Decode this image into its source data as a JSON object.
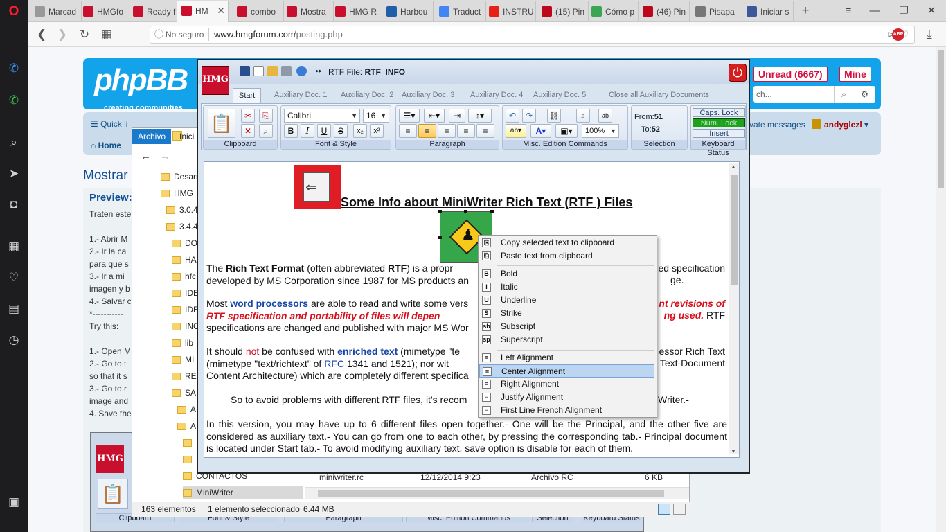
{
  "browser": {
    "tabs": [
      {
        "label": "Marcad",
        "color": "#999999"
      },
      {
        "label": "HMGfo",
        "color": "#c8102e"
      },
      {
        "label": "Ready f",
        "color": "#c8102e"
      },
      {
        "label": "HM",
        "color": "#c8102e"
      },
      {
        "label": "combo",
        "color": "#c8102e"
      },
      {
        "label": "Mostra",
        "color": "#c8102e"
      },
      {
        "label": "HMG R",
        "color": "#c8102e"
      },
      {
        "label": "Harbou",
        "color": "#1f5fa8"
      },
      {
        "label": "Traduct",
        "color": "#4285f4"
      },
      {
        "label": "INSTRU",
        "color": "#e62117"
      },
      {
        "label": "(15) Pin",
        "color": "#bd081c"
      },
      {
        "label": "Cómo p",
        "color": "#3aa655"
      },
      {
        "label": "(46) Pin",
        "color": "#bd081c"
      },
      {
        "label": "Pisapa",
        "color": "#777777"
      },
      {
        "label": "Iniciar s",
        "color": "#3b5998"
      }
    ],
    "security": "No seguro",
    "url_domain": "www.hmgforum.com",
    "url_path": "/posting.php"
  },
  "forum": {
    "logo": "phpBB",
    "logo_sub": "creating communities",
    "unread": "Unread (6667)",
    "mine": "Mine",
    "search_placeholder": "ch...",
    "quick_links": "Quick li",
    "home": "Home",
    "private_messages": "vate messages",
    "user": "andyglezl",
    "page_title": "Mostrar",
    "preview": "Preview:",
    "preview_lines": [
      "Traten este",
      "1.- Abrir M",
      "2.- Ir la ca",
      "para que s",
      "3.- Ir a mi",
      "imagen y b",
      "4.- Salvar c",
      "*-----------",
      "Try this:",
      "1.- Open M",
      "2.- Go to t",
      "so that it s",
      "3.- Go to r",
      "image and",
      "4. Save the"
    ]
  },
  "explorer": {
    "ribbon_tabs": [
      "Archivo",
      "Inici"
    ],
    "tree": [
      "Desarr",
      "HMG",
      "3.0.4",
      "3.4.4",
      "DO",
      "HA",
      "hfc",
      "IDE",
      "IDE",
      "INC",
      "lib",
      "MI",
      "RES",
      "SAI",
      "A",
      "A",
      "",
      "",
      "CONTACTOS",
      "MiniWriter"
    ],
    "file_name": "miniwriter.rc",
    "file_date": "12/12/2014 9:23",
    "file_type": "Archivo RC",
    "file_size": "6 KB",
    "status_count": "163 elementos",
    "status_sel": "1 elemento seleccionado",
    "status_size": "6.44 MB"
  },
  "miniwriter": {
    "logo": "HMG",
    "rtf_label": "RTF File:",
    "rtf_name": "RTF_INFO",
    "tabs": [
      "Start",
      "Auxiliary Doc. 1",
      "Auxiliary Doc. 2",
      "Auxiliary Doc. 3",
      "Auxiliary Doc. 4",
      "Auxiliary Doc. 5",
      "Close all Auxiliary Documents"
    ],
    "groups": {
      "clipboard": "Clipboard",
      "font": "Font & Style",
      "paragraph": "Paragraph",
      "misc": "Misc. Edition Commands",
      "selection": "Selection",
      "keyboard": "Keyboard Status"
    },
    "font_name": "Calibri",
    "font_size": "16",
    "zoom": "100%",
    "from_label": "From:",
    "from_val": "51",
    "to_label": "To:",
    "to_val": "52",
    "caps": "Caps. Lock",
    "num": "Num. Lock",
    "insert": "Insert",
    "bold": "B",
    "italic": "I",
    "underline": "U",
    "strike": "S",
    "sub": "x₂",
    "sup": "x²"
  },
  "document": {
    "heading": "Some Info about MiniWriter Rich Text (RTF ) Files",
    "p1_a": "The ",
    "p1_b": "Rich Text Format",
    "p1_c": " (often abbreviated ",
    "p1_d": "RTF",
    "p1_e": ") is a propr",
    "p1_f": "ed specification",
    "p1_g": "developed by MS Corporation since 1987 for MS products an",
    "p1_h": "ge.",
    "p2_a": "Most ",
    "p2_b": "word processors",
    "p2_c": " are able to read and write some vers",
    "p2_d": "nt revisions of",
    "p2_e": "RTF specification and portability of files will depen",
    "p2_f": "ng used.",
    "p2_g": " RTF",
    "p2_h": "specifications are changed and published with major MS Wor",
    "p3_a": "It should ",
    "p3_b": "not",
    "p3_c": " be confused with ",
    "p3_d": "enriched text",
    "p3_e": " (mimetype \"te",
    "p3_f": "essor Rich Text",
    "p3_g": "(mimetype \"text/richtext\" of ",
    "p3_h": "RFC",
    "p3_i": " 1341 and 1521); nor wit",
    "p3_j": "Text-Document",
    "p3_k": "Content Architecture) which are completely different specifica",
    "p4_a": "So to avoid problems with different RTF files, it's recom",
    "p4_b": "iniWriter.-",
    "p5": "In this version, you may have up to 6 different files open together.- One will be the Principal, and the other five are considered as auxiliary text.- You can go from one to each other, by pressing the corresponding tab.- Principal document is located under Start tab.- To avoid modifying auxiliary text, save option is disable for each of them."
  },
  "context_menu": {
    "items": [
      {
        "label": "Copy selected text to clipboard",
        "icon": "copy-icon"
      },
      {
        "label": "Paste text from clipboard",
        "icon": "paste-icon"
      },
      {
        "label": "Bold",
        "icon": "bold-icon"
      },
      {
        "label": "Italic",
        "icon": "italic-icon"
      },
      {
        "label": "Underline",
        "icon": "underline-icon"
      },
      {
        "label": "Strike",
        "icon": "strike-icon"
      },
      {
        "label": "Subscript",
        "icon": "subscript-icon"
      },
      {
        "label": "Superscript",
        "icon": "superscript-icon"
      },
      {
        "label": "Left Alignment",
        "icon": "align-left-icon"
      },
      {
        "label": "Center Alignment",
        "icon": "align-center-icon"
      },
      {
        "label": "Right Alignment",
        "icon": "align-right-icon"
      },
      {
        "label": "Justify Alignment",
        "icon": "align-justify-icon"
      },
      {
        "label": "First Line French Alignment",
        "icon": "align-french-icon"
      }
    ]
  },
  "bg_miniwriter": {
    "logo": "HMG",
    "labels": [
      "Clipboard",
      "Font & Style",
      "Paragraph",
      "Misc. Edition Commands",
      "Selection",
      "Keyboard Status"
    ]
  }
}
